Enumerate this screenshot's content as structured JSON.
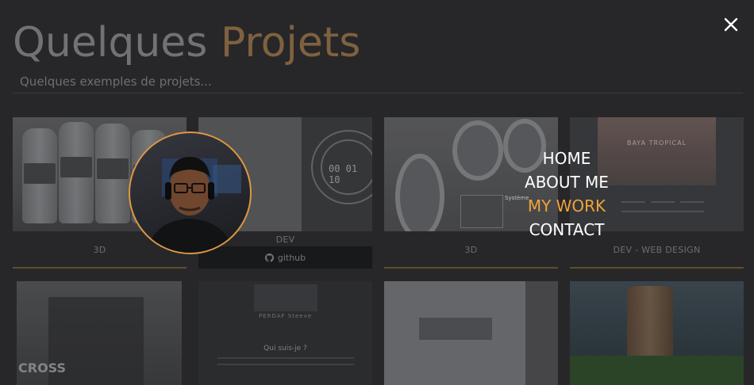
{
  "page": {
    "title_main": "Quelques",
    "title_accent": "Projets",
    "subtitle": "Quelques exemples de projets..."
  },
  "projects_row1": [
    {
      "category": "3D"
    },
    {
      "category": "DEV",
      "button_label": "github",
      "button_icon": "github-icon",
      "clock": "00 01 10"
    },
    {
      "category": "3D",
      "overlay_text": "Système"
    },
    {
      "category": "DEV - WEB DESIGN",
      "thumb_text": "BAYA TROPICAL"
    }
  ],
  "projects_row2": [
    {
      "thumb_text": "CROSS"
    },
    {
      "thumb_text": "PERDAF Steeve",
      "thumb_text2": "Qui suis-je ?"
    },
    {
      "thumb_text": ""
    },
    {
      "thumb_text": ""
    }
  ],
  "nav": {
    "items": [
      "HOME",
      "ABOUT ME",
      "MY WORK",
      "CONTACT"
    ],
    "active_index": 2,
    "close_icon": "close-icon"
  },
  "colors": {
    "accent": "#f0a33a",
    "background": "#2b2b2d",
    "nav_text": "#ffffff"
  }
}
